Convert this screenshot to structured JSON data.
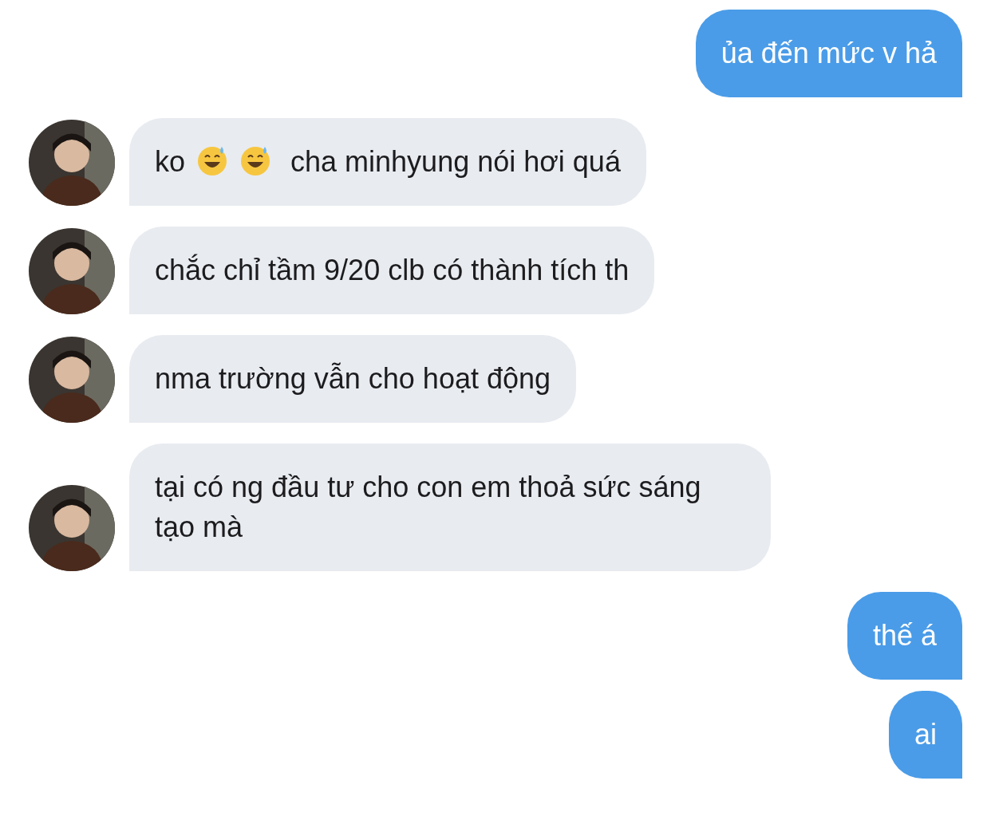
{
  "messages": [
    {
      "kind": "sent",
      "parts": [
        {
          "kind": "text",
          "text": "ủa đến mức v hả"
        }
      ]
    },
    {
      "kind": "received",
      "parts": [
        {
          "kind": "text",
          "text": "ko"
        },
        {
          "kind": "emoji"
        },
        {
          "kind": "emoji"
        },
        {
          "kind": "text",
          "text": "cha minhyung nói hơi quá"
        }
      ]
    },
    {
      "kind": "received",
      "parts": [
        {
          "kind": "text",
          "text": "chắc chỉ tầm 9/20 clb có thành tích th"
        }
      ]
    },
    {
      "kind": "received",
      "parts": [
        {
          "kind": "text",
          "text": "nma trường vẫn cho hoạt động"
        }
      ]
    },
    {
      "kind": "received",
      "parts": [
        {
          "kind": "text",
          "text": "tại có ng đầu tư cho con em thoả sức sáng tạo mà"
        }
      ]
    },
    {
      "kind": "sent",
      "parts": [
        {
          "kind": "text",
          "text": "thế á"
        }
      ]
    },
    {
      "kind": "sent",
      "parts": [
        {
          "kind": "text",
          "text": "ai"
        }
      ]
    }
  ]
}
